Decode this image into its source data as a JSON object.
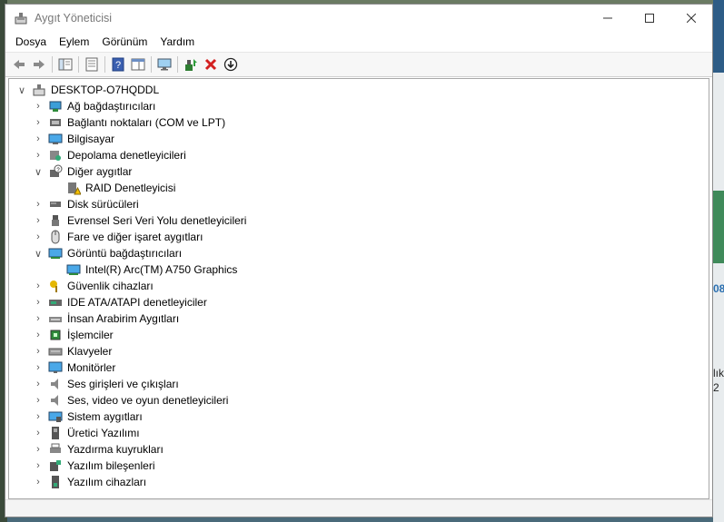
{
  "window": {
    "title": "Aygıt Yöneticisi"
  },
  "menu": {
    "items": [
      "Dosya",
      "Eylem",
      "Görünüm",
      "Yardım"
    ]
  },
  "tree": {
    "root": "DESKTOP-O7HQDDL",
    "nodes": [
      {
        "label": "Ağ bağdaştırıcıları",
        "icon": "network-adapter-icon"
      },
      {
        "label": "Bağlantı noktaları (COM ve LPT)",
        "icon": "port-icon"
      },
      {
        "label": "Bilgisayar",
        "icon": "computer-icon"
      },
      {
        "label": "Depolama denetleyicileri",
        "icon": "storage-controller-icon"
      },
      {
        "label": "Diğer aygıtlar",
        "icon": "other-devices-icon",
        "expanded": true,
        "children": [
          {
            "label": "RAID Denetleyicisi",
            "icon": "warning-device-icon"
          }
        ]
      },
      {
        "label": "Disk sürücüleri",
        "icon": "disk-drive-icon"
      },
      {
        "label": "Evrensel Seri Veri Yolu denetleyicileri",
        "icon": "usb-icon"
      },
      {
        "label": "Fare ve diğer işaret aygıtları",
        "icon": "mouse-icon"
      },
      {
        "label": "Görüntü bağdaştırıcıları",
        "icon": "display-adapter-icon",
        "expanded": true,
        "children": [
          {
            "label": "Intel(R) Arc(TM) A750 Graphics",
            "icon": "display-adapter-icon"
          }
        ]
      },
      {
        "label": "Güvenlik cihazları",
        "icon": "security-key-icon"
      },
      {
        "label": "IDE ATA/ATAPI denetleyiciler",
        "icon": "ide-icon"
      },
      {
        "label": "İnsan Arabirim Aygıtları",
        "icon": "hid-icon"
      },
      {
        "label": "İşlemciler",
        "icon": "processor-icon"
      },
      {
        "label": "Klavyeler",
        "icon": "keyboard-icon"
      },
      {
        "label": "Monitörler",
        "icon": "monitor-icon"
      },
      {
        "label": "Ses girişleri ve çıkışları",
        "icon": "speaker-icon"
      },
      {
        "label": "Ses, video ve oyun denetleyicileri",
        "icon": "sound-video-icon"
      },
      {
        "label": "Sistem aygıtları",
        "icon": "system-devices-icon"
      },
      {
        "label": "Üretici Yazılımı",
        "icon": "firmware-icon"
      },
      {
        "label": "Yazdırma kuyrukları",
        "icon": "printer-icon"
      },
      {
        "label": "Yazılım bileşenleri",
        "icon": "software-component-icon"
      },
      {
        "label": "Yazılım cihazları",
        "icon": "software-device-icon"
      }
    ]
  },
  "desktop": {
    "fragments": [
      "08",
      "lık",
      "2"
    ]
  }
}
